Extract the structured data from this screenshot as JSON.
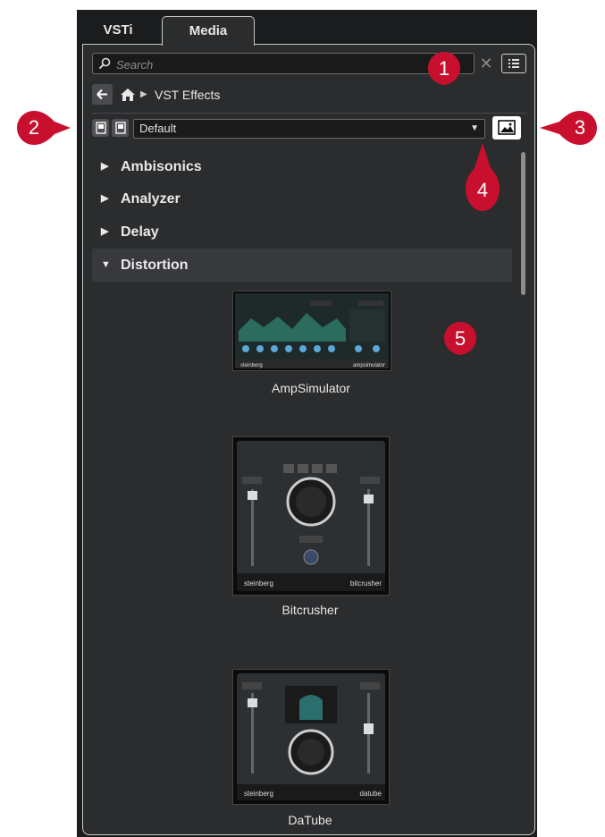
{
  "tabs": [
    {
      "label": "VSTi"
    },
    {
      "label": "Media"
    }
  ],
  "search": {
    "placeholder": "Search",
    "value": ""
  },
  "breadcrumb": {
    "path": "VST Effects"
  },
  "preset": {
    "selected": "Default"
  },
  "categories": [
    {
      "label": "Ambisonics",
      "expanded": false
    },
    {
      "label": "Analyzer",
      "expanded": false
    },
    {
      "label": "Delay",
      "expanded": false
    },
    {
      "label": "Distortion",
      "expanded": true
    }
  ],
  "plugins": [
    {
      "name": "AmpSimulator",
      "brand": "steinberg",
      "product": "ampsimulator"
    },
    {
      "name": "Bitcrusher",
      "brand": "steinberg",
      "product": "bitcrusher"
    },
    {
      "name": "DaTube",
      "brand": "steinberg",
      "product": "datube"
    }
  ],
  "callouts": [
    "1",
    "2",
    "3",
    "4",
    "5"
  ],
  "colors": {
    "callout": "#c8102e",
    "panel": "#2b2c2e",
    "app_bg": "#1b1c1e"
  }
}
